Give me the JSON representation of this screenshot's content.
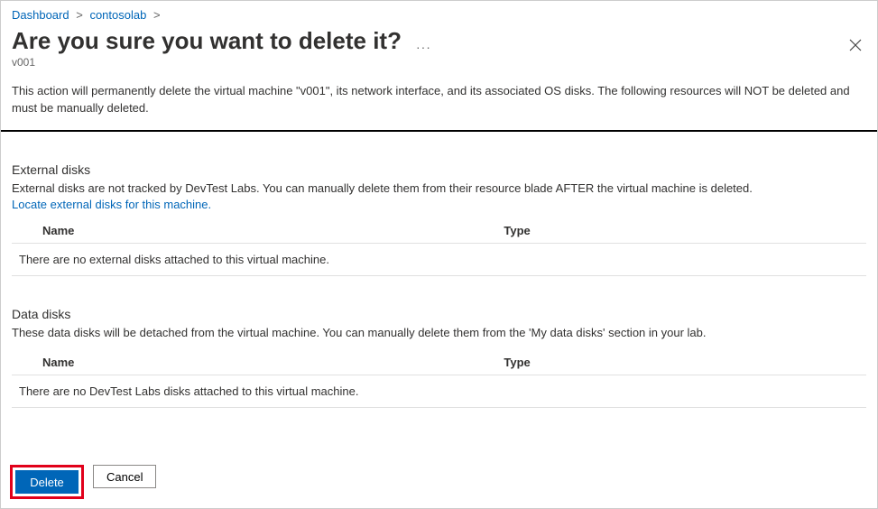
{
  "breadcrumb": {
    "dashboard": "Dashboard",
    "lab": "contosolab"
  },
  "header": {
    "title": "Are you sure you want to delete it?",
    "subtitle": "v001"
  },
  "description": "This action will permanently delete the virtual machine \"v001\", its network interface, and its associated OS disks. The following resources will NOT be deleted and must be manually deleted.",
  "externalDisks": {
    "title": "External disks",
    "desc": "External disks are not tracked by DevTest Labs. You can manually delete them from their resource blade AFTER the virtual machine is deleted.",
    "link": "Locate external disks for this machine.",
    "columns": {
      "name": "Name",
      "type": "Type"
    },
    "empty": "There are no external disks attached to this virtual machine."
  },
  "dataDisks": {
    "title": "Data disks",
    "desc": "These data disks will be detached from the virtual machine. You can manually delete them from the 'My data disks' section in your lab.",
    "columns": {
      "name": "Name",
      "type": "Type"
    },
    "empty": "There are no DevTest Labs disks attached to this virtual machine."
  },
  "buttons": {
    "delete": "Delete",
    "cancel": "Cancel"
  }
}
